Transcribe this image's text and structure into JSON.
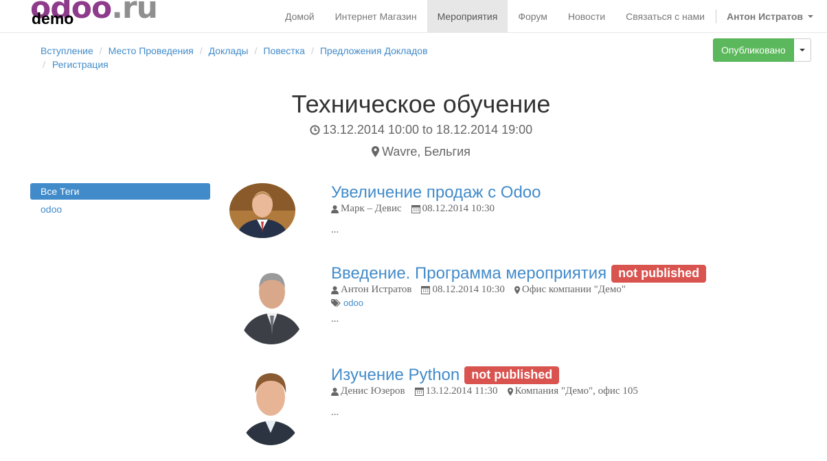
{
  "logo": {
    "brand_primary": "odoo",
    "brand_secondary": ".ru",
    "overlay": "demo"
  },
  "nav": {
    "items": [
      "Домой",
      "Интернет Магазин",
      "Мероприятия",
      "Форум",
      "Новости",
      "Связаться с нами"
    ],
    "active_index": 2,
    "user": "Антон Истратов"
  },
  "breadcrumb": [
    "Вступление",
    "Место Проведения",
    "Доклады",
    "Повестка",
    "Предложения Докладов",
    "Регистрация"
  ],
  "publish": {
    "label": "Опубликовано"
  },
  "event": {
    "title": "Техническое обучение",
    "date_range": "13.12.2014 10:00 to 18.12.2014 19:00",
    "location": "Wavre, Бельгия"
  },
  "sidebar": {
    "tags": [
      "Все Теги",
      "odoo"
    ]
  },
  "talks": [
    {
      "title": "Увеличение продаж с Odoo",
      "badge": "",
      "speaker": "Марк – Девис",
      "datetime": "08.12.2014 10:30",
      "place": "",
      "tag": "",
      "summary": "..."
    },
    {
      "title": "Введение. Программа мероприятия",
      "badge": "not published",
      "speaker": "Антон Истратов",
      "datetime": "08.12.2014 10:30",
      "place": "Офис компании \"Демо\"",
      "tag": "odoo",
      "summary": "..."
    },
    {
      "title": "Изучение Python",
      "badge": "not published",
      "speaker": "Денис Юзеров",
      "datetime": "13.12.2014 11:30",
      "place": "Компания \"Демо\", офис 105",
      "tag": "",
      "summary": "..."
    }
  ],
  "colors": {
    "link": "#428bca",
    "published": "#5cb85c",
    "badge": "#d9534f",
    "brand": "#8f3b8b"
  },
  "icons": [
    "clock-icon",
    "map-marker-icon",
    "user-icon",
    "calendar-icon",
    "tag-icon",
    "caret-down-icon"
  ]
}
